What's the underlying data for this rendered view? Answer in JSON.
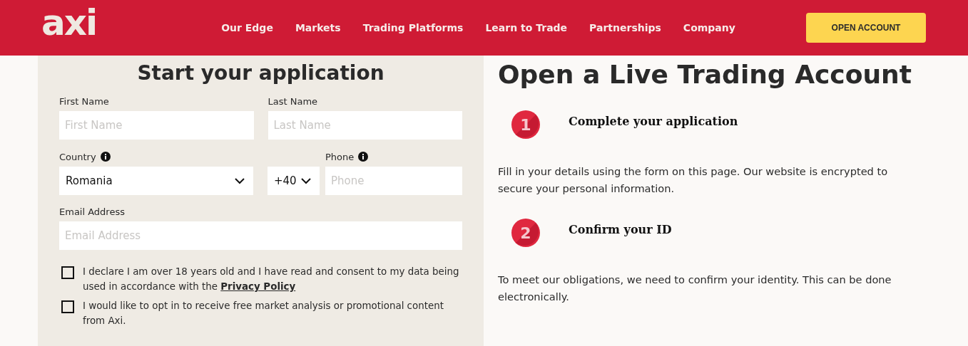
{
  "header": {
    "logo": "axi",
    "nav": [
      "Our Edge",
      "Markets",
      "Trading Platforms",
      "Learn to Trade",
      "Partnerships",
      "Company"
    ],
    "cta": "OPEN ACCOUNT"
  },
  "form": {
    "title": "Start your application",
    "name_fields": [
      {
        "label": "First Name",
        "placeholder": "First Name"
      },
      {
        "label": "Last Name",
        "placeholder": "Last Name"
      }
    ],
    "country": {
      "label": "Country",
      "value": "Romania"
    },
    "phone_code": {
      "value": "+40"
    },
    "phone": {
      "label": "Phone",
      "placeholder": "Phone"
    },
    "email": {
      "label": "Email Address",
      "placeholder": "Email Address"
    },
    "consents": [
      {
        "text": "I declare I am over 18 years old and I have read and consent to my data being used in accordance with the ",
        "link": "Privacy Policy",
        "checked": false
      },
      {
        "text": "I would like to opt in to receive free market analysis or promotional content from Axi.",
        "checked": false
      }
    ]
  },
  "info": {
    "title": "Open a Live Trading Account",
    "steps": [
      {
        "number": "1",
        "title": "Complete your application",
        "text": "Fill in your details using the form on this page. Our website is encrypted to secure your personal information."
      },
      {
        "number": "2",
        "title": "Confirm your ID",
        "text": "To meet our obligations, we need to confirm your identity. This can be done electronically."
      }
    ]
  }
}
